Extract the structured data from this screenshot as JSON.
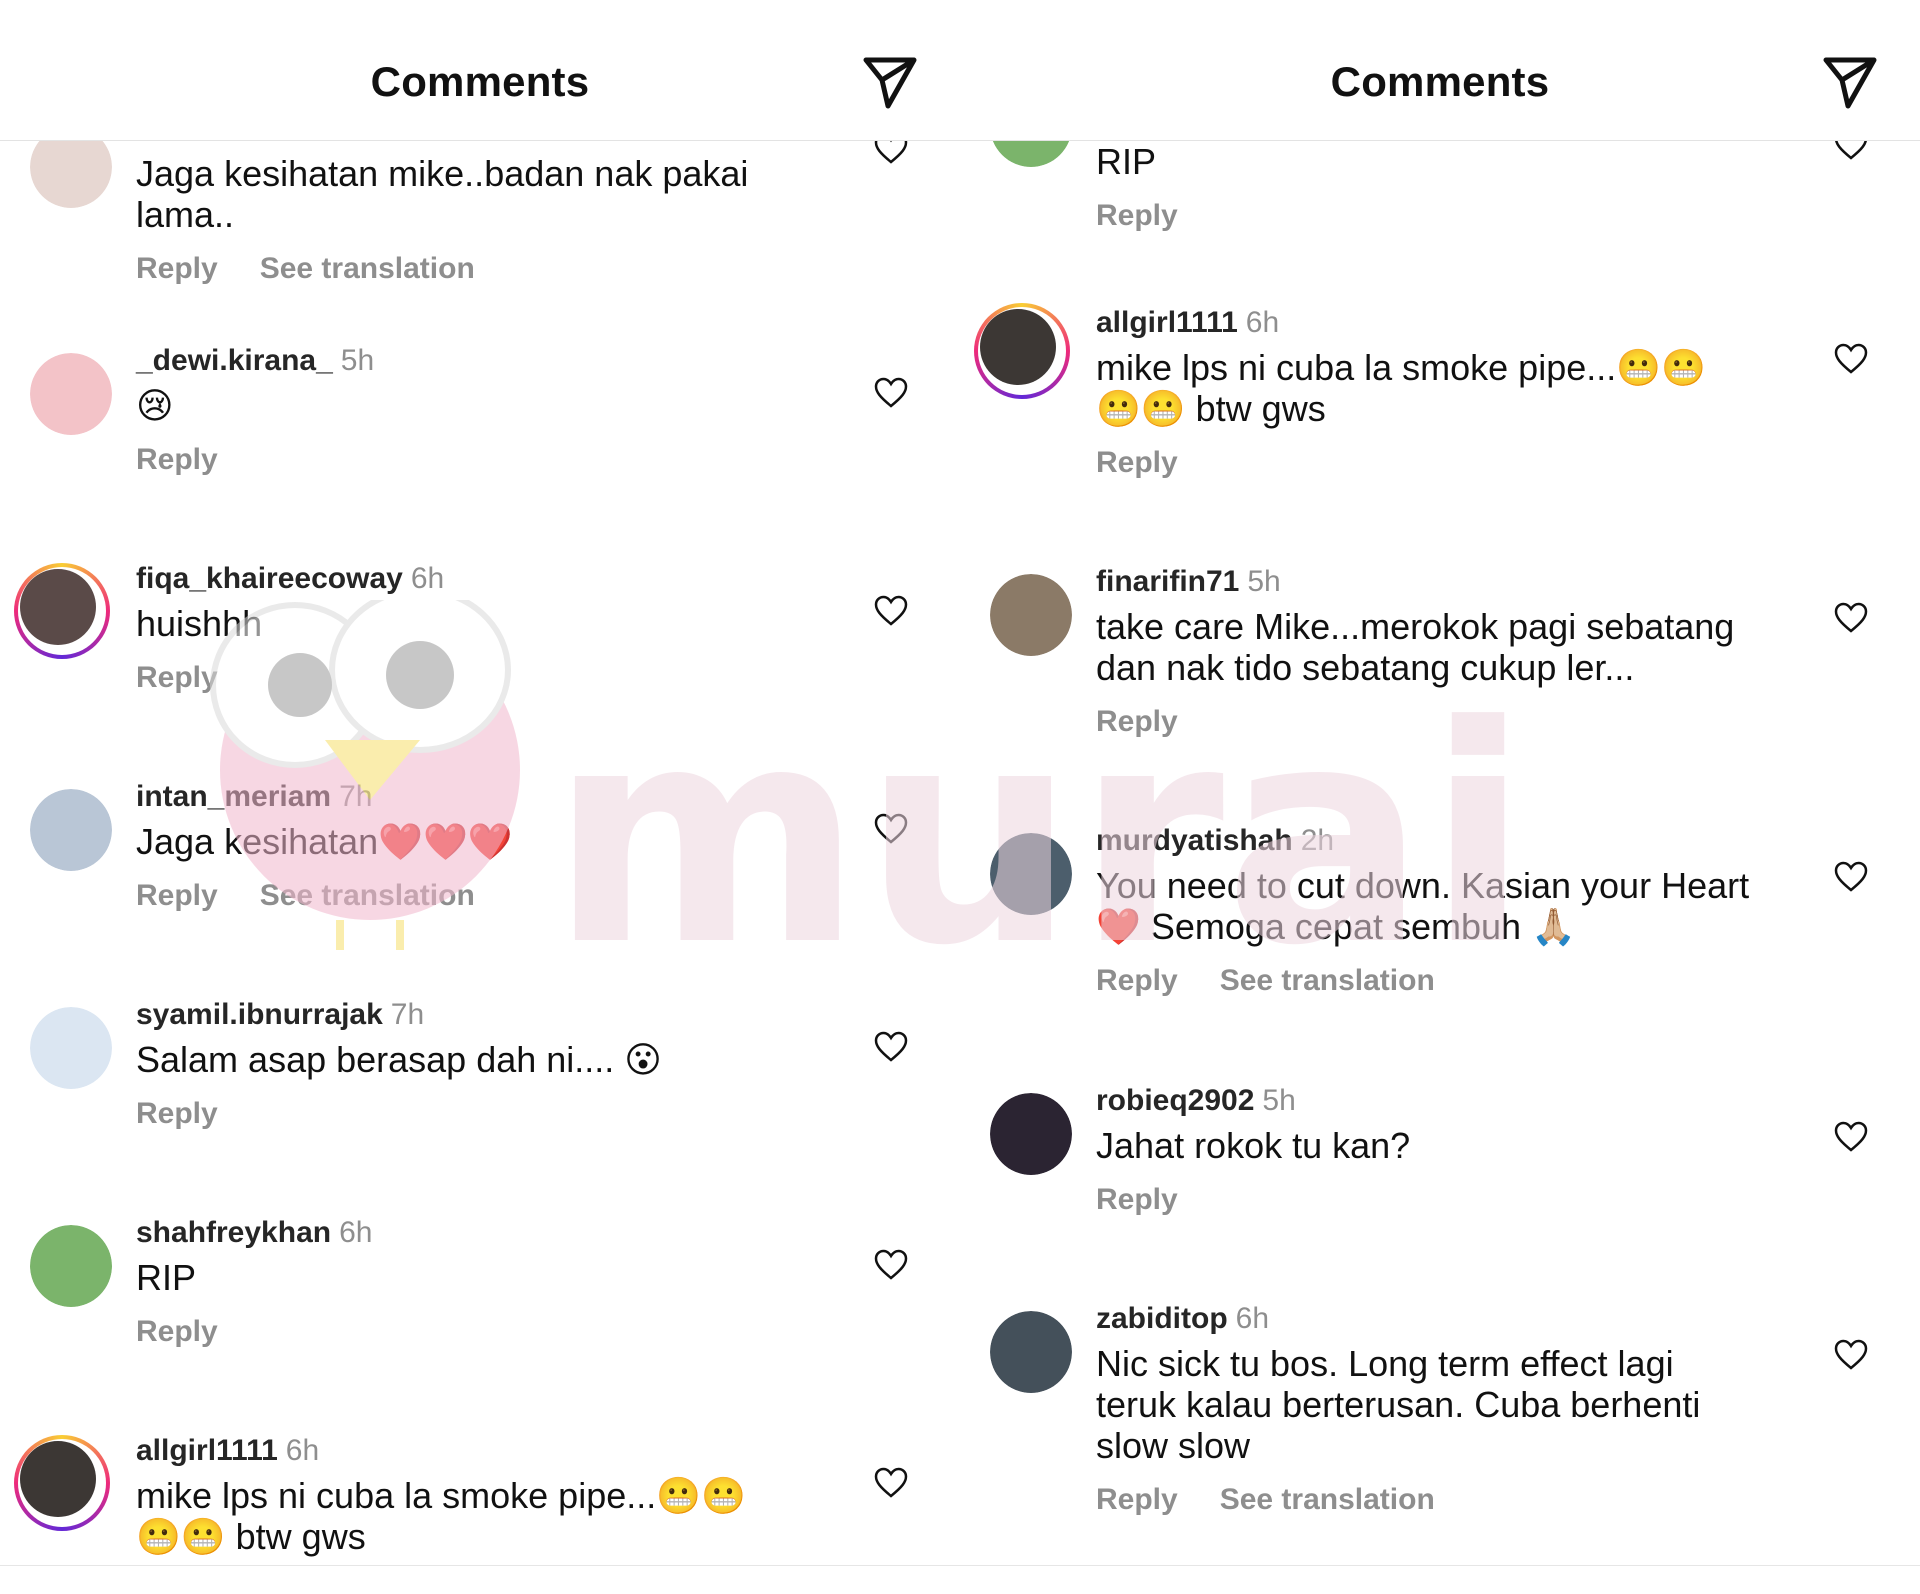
{
  "panels": [
    {
      "title": "Comments",
      "comments": [
        {
          "username": "",
          "time": "",
          "text": "Jaga kesihatan mike..badan nak pakai\nlama..",
          "actions": [
            "Reply",
            "See translation"
          ],
          "avatar_color": "#e7d7d2"
        },
        {
          "username": "_dewi.kirana_",
          "time": "5h",
          "text": "😢",
          "actions": [
            "Reply"
          ],
          "avatar_color": "#f3c3c8"
        },
        {
          "username": "fiqa_khaireecoway",
          "time": "6h",
          "text": "huishhh",
          "actions": [
            "Reply"
          ],
          "avatar_color": "#5a4a48"
        },
        {
          "username": "intan_meriam",
          "time": "7h",
          "text": "Jaga kesihatan❤️❤️❤️",
          "actions": [
            "Reply",
            "See translation"
          ],
          "avatar_color": "#b9c6d6"
        },
        {
          "username": "syamil.ibnurrajak",
          "time": "7h",
          "text": "Salam asap berasap dah ni.... 😮",
          "actions": [
            "Reply"
          ],
          "avatar_color": "#dbe6f2"
        },
        {
          "username": "shahfreykhan",
          "time": "6h",
          "text": "RIP",
          "actions": [
            "Reply"
          ],
          "avatar_color": "#7bb46b"
        },
        {
          "username": "allgirl1111",
          "time": "6h",
          "text": "mike lps ni cuba la smoke pipe...😬😬\n😬😬 btw gws",
          "actions": [],
          "avatar_color": "#3c3734"
        }
      ]
    },
    {
      "title": "Comments",
      "comments": [
        {
          "username": "",
          "time": "",
          "text": "RIP",
          "actions": [
            "Reply"
          ],
          "avatar_color": "#7bb46b"
        },
        {
          "username": "allgirl1111",
          "time": "6h",
          "text": "mike lps ni cuba la smoke pipe...😬😬\n😬😬 btw gws",
          "actions": [
            "Reply"
          ],
          "avatar_color": "#3c3734"
        },
        {
          "username": "finarifin71",
          "time": "5h",
          "text": "take care Mike...merokok pagi sebatang\ndan nak tido sebatang cukup ler...",
          "actions": [
            "Reply"
          ],
          "avatar_color": "#8b7a67"
        },
        {
          "username": "murdyatishah",
          "time": "2h",
          "text": "You need to cut down. Kasian your Heart\n❤️ Semoga cepat sembuh 🙏🏼",
          "actions": [
            "Reply",
            "See translation"
          ],
          "avatar_color": "#4c5e6c"
        },
        {
          "username": "robieq2902",
          "time": "5h",
          "text": "Jahat rokok tu kan?",
          "actions": [
            "Reply"
          ],
          "avatar_color": "#2b2432"
        },
        {
          "username": "zabiditop",
          "time": "6h",
          "text": "Nic sick tu bos. Long term effect lagi\nteruk kalau berterusan. Cuba berhenti\nslow slow",
          "actions": [
            "Reply",
            "See translation"
          ],
          "avatar_color": "#44505a"
        }
      ]
    }
  ],
  "watermark_text": "murai",
  "colors": {
    "story_ring_start": "#f9ce34",
    "story_ring_mid": "#ee2a7b",
    "story_ring_end": "#6228d7",
    "muted": "#8e8e8e",
    "watermark": "#eed6e0"
  }
}
